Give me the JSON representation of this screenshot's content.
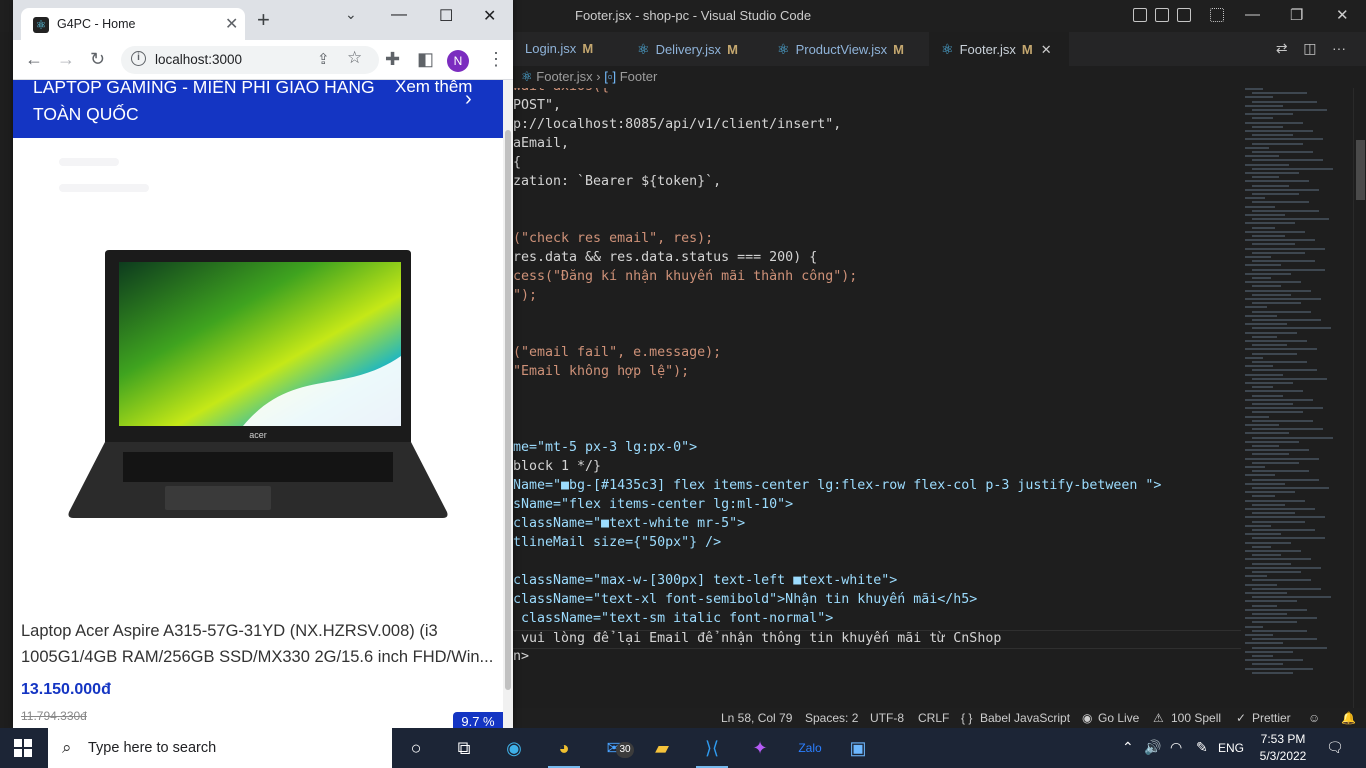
{
  "vscode": {
    "title": "Footer.jsx - shop-pc - Visual Studio Code",
    "tabs": [
      {
        "name": "Login.jsx",
        "status": "M"
      },
      {
        "name": "Delivery.jsx",
        "status": "M"
      },
      {
        "name": "ProductView.jsx",
        "status": "M"
      },
      {
        "name": "Footer.jsx",
        "status": "M"
      }
    ],
    "breadcrumb": {
      "file": "Footer.jsx",
      "symbol": "Footer"
    },
    "code_lines": [
      "wait axios({",
      "POST\",",
      "p://localhost:8085/api/v1/client/insert\",",
      "aEmail,",
      "{",
      "zation: `Bearer ${token}`,",
      "",
      "",
      "(\"check res email\", res);",
      "res.data && res.data.status === 200) {",
      "cess(\"Đăng kí nhận khuyến mãi thành công\");",
      "\");",
      "",
      "",
      "(\"email fail\", e.message);",
      "\"Email không hợp lệ\");",
      "",
      "",
      "",
      "me=\"mt-5 px-3 lg:px-0\">",
      "block 1 */}",
      "Name=\"■bg-[#1435c3] flex items-center lg:flex-row flex-col p-3 justify-between \">",
      "sName=\"flex items-center lg:ml-10\">",
      "className=\"■text-white mr-5\">",
      "tlineMail size={\"50px\"} />",
      "",
      "className=\"max-w-[300px] text-left ■text-white\">",
      "className=\"text-xl font-semibold\">Nhận tin khuyến mãi</h5>",
      " className=\"text-sm italic font-normal\">",
      " vui lòng để lại Email để nhận thông tin khuyến mãi từ CnShop",
      "n>"
    ],
    "status_bar": {
      "position": "Ln 58, Col 79",
      "spaces": "Spaces: 2",
      "encoding": "UTF-8",
      "eol": "CRLF",
      "language": "Babel JavaScript",
      "go_live": "Go Live",
      "spell": "100 Spell",
      "prettier": "Prettier"
    }
  },
  "chrome": {
    "tab_title": "G4PC - Home",
    "url": "localhost:3000",
    "profile_initial": "N"
  },
  "page": {
    "promo_text": "LAPTOP GAMING - MIỄN PHÍ GIAO HÀNG TOÀN QUỐC",
    "promo_more": "Xem thêm",
    "product": {
      "name": "Laptop Acer Aspire A315-57G-31YD (NX.HZRSV.008) (i3 1005G1/4GB RAM/256GB SSD/MX330 2G/15.6 inch FHD/Win...",
      "price": "13.150.000đ",
      "old_price": "11.794.330đ",
      "discount": "9.7 %",
      "brand_on_image": "acer"
    }
  },
  "taskbar": {
    "search_placeholder": "Type here to search",
    "mail_badge": "30",
    "language": "ENG",
    "time": "7:53 PM",
    "date": "5/3/2022",
    "apps": [
      "task-view-icon",
      "edge-icon",
      "chrome-icon",
      "mail-icon",
      "file-explorer-icon",
      "vscode-icon",
      "messenger-icon",
      "zalo-icon",
      "photos-icon"
    ]
  },
  "colors": {
    "brand": "#1435c3",
    "vscode_bg": "#1e1e1e",
    "taskbar_bg": "#1c2536"
  }
}
